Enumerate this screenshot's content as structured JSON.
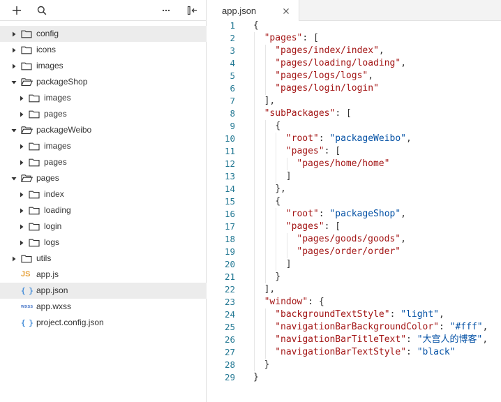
{
  "toolbar": {
    "icons": [
      "add-icon",
      "search-icon",
      "more-icon",
      "collapse-panel-icon"
    ]
  },
  "tree": [
    {
      "label": "config",
      "type": "folder",
      "expanded": false,
      "depth": 0,
      "selected": true
    },
    {
      "label": "icons",
      "type": "folder",
      "expanded": false,
      "depth": 0
    },
    {
      "label": "images",
      "type": "folder",
      "expanded": false,
      "depth": 0
    },
    {
      "label": "packageShop",
      "type": "folder",
      "expanded": true,
      "depth": 0
    },
    {
      "label": "images",
      "type": "folder",
      "expanded": false,
      "depth": 1
    },
    {
      "label": "pages",
      "type": "folder",
      "expanded": false,
      "depth": 1
    },
    {
      "label": "packageWeibo",
      "type": "folder",
      "expanded": true,
      "depth": 0
    },
    {
      "label": "images",
      "type": "folder",
      "expanded": false,
      "depth": 1
    },
    {
      "label": "pages",
      "type": "folder",
      "expanded": false,
      "depth": 1
    },
    {
      "label": "pages",
      "type": "folder",
      "expanded": true,
      "depth": 0
    },
    {
      "label": "index",
      "type": "folder",
      "expanded": false,
      "depth": 1
    },
    {
      "label": "loading",
      "type": "folder",
      "expanded": false,
      "depth": 1
    },
    {
      "label": "login",
      "type": "folder",
      "expanded": false,
      "depth": 1
    },
    {
      "label": "logs",
      "type": "folder",
      "expanded": false,
      "depth": 1
    },
    {
      "label": "utils",
      "type": "folder",
      "expanded": false,
      "depth": 0
    },
    {
      "label": "app.js",
      "type": "file",
      "badge": "JS",
      "badgeClass": "badge-js",
      "depth": 0
    },
    {
      "label": "app.json",
      "type": "file",
      "badge": "{ }",
      "badgeClass": "badge-json",
      "depth": 0,
      "selected": true
    },
    {
      "label": "app.wxss",
      "type": "file",
      "badge": "wxss",
      "badgeClass": "badge-wxss",
      "depth": 0
    },
    {
      "label": "project.config.json",
      "type": "file",
      "badge": "{ }",
      "badgeClass": "badge-json",
      "depth": 0
    }
  ],
  "editor": {
    "tab_title": "app.json",
    "lines": [
      {
        "n": "1",
        "indent": 0,
        "tokens": [
          [
            "p",
            "{"
          ]
        ]
      },
      {
        "n": "2",
        "indent": 1,
        "tokens": [
          [
            "k",
            "\"pages\""
          ],
          [
            "p",
            ": ["
          ]
        ]
      },
      {
        "n": "3",
        "indent": 2,
        "tokens": [
          [
            "k",
            "\"pages/index/index\""
          ],
          [
            "p",
            ","
          ]
        ]
      },
      {
        "n": "4",
        "indent": 2,
        "tokens": [
          [
            "k",
            "\"pages/loading/loading\""
          ],
          [
            "p",
            ","
          ]
        ]
      },
      {
        "n": "5",
        "indent": 2,
        "tokens": [
          [
            "k",
            "\"pages/logs/logs\""
          ],
          [
            "p",
            ","
          ]
        ]
      },
      {
        "n": "6",
        "indent": 2,
        "tokens": [
          [
            "k",
            "\"pages/login/login\""
          ]
        ]
      },
      {
        "n": "7",
        "indent": 1,
        "tokens": [
          [
            "p",
            "],"
          ]
        ]
      },
      {
        "n": "8",
        "indent": 1,
        "tokens": [
          [
            "k",
            "\"subPackages\""
          ],
          [
            "p",
            ": ["
          ]
        ]
      },
      {
        "n": "9",
        "indent": 2,
        "tokens": [
          [
            "p",
            "{"
          ]
        ]
      },
      {
        "n": "10",
        "indent": 3,
        "tokens": [
          [
            "k",
            "\"root\""
          ],
          [
            "p",
            ": "
          ],
          [
            "s",
            "\"packageWeibo\""
          ],
          [
            "p",
            ","
          ]
        ]
      },
      {
        "n": "11",
        "indent": 3,
        "tokens": [
          [
            "k",
            "\"pages\""
          ],
          [
            "p",
            ": ["
          ]
        ]
      },
      {
        "n": "12",
        "indent": 4,
        "tokens": [
          [
            "k",
            "\"pages/home/home\""
          ]
        ]
      },
      {
        "n": "13",
        "indent": 3,
        "tokens": [
          [
            "p",
            "]"
          ]
        ]
      },
      {
        "n": "14",
        "indent": 2,
        "tokens": [
          [
            "p",
            "},"
          ]
        ]
      },
      {
        "n": "15",
        "indent": 2,
        "tokens": [
          [
            "p",
            "{"
          ]
        ]
      },
      {
        "n": "16",
        "indent": 3,
        "tokens": [
          [
            "k",
            "\"root\""
          ],
          [
            "p",
            ": "
          ],
          [
            "s",
            "\"packageShop\""
          ],
          [
            "p",
            ","
          ]
        ]
      },
      {
        "n": "17",
        "indent": 3,
        "tokens": [
          [
            "k",
            "\"pages\""
          ],
          [
            "p",
            ": ["
          ]
        ]
      },
      {
        "n": "18",
        "indent": 4,
        "tokens": [
          [
            "k",
            "\"pages/goods/goods\""
          ],
          [
            "p",
            ","
          ]
        ]
      },
      {
        "n": "19",
        "indent": 4,
        "tokens": [
          [
            "k",
            "\"pages/order/order\""
          ]
        ]
      },
      {
        "n": "20",
        "indent": 3,
        "tokens": [
          [
            "p",
            "]"
          ]
        ]
      },
      {
        "n": "21",
        "indent": 2,
        "tokens": [
          [
            "p",
            "}"
          ]
        ]
      },
      {
        "n": "22",
        "indent": 1,
        "tokens": [
          [
            "p",
            "],"
          ]
        ]
      },
      {
        "n": "23",
        "indent": 1,
        "tokens": [
          [
            "k",
            "\"window\""
          ],
          [
            "p",
            ": {"
          ]
        ]
      },
      {
        "n": "24",
        "indent": 2,
        "tokens": [
          [
            "k",
            "\"backgroundTextStyle\""
          ],
          [
            "p",
            ": "
          ],
          [
            "s",
            "\"light\""
          ],
          [
            "p",
            ","
          ]
        ]
      },
      {
        "n": "25",
        "indent": 2,
        "tokens": [
          [
            "k",
            "\"navigationBarBackgroundColor\""
          ],
          [
            "p",
            ": "
          ],
          [
            "s",
            "\"#fff\""
          ],
          [
            "p",
            ","
          ]
        ]
      },
      {
        "n": "26",
        "indent": 2,
        "tokens": [
          [
            "k",
            "\"navigationBarTitleText\""
          ],
          [
            "p",
            ": "
          ],
          [
            "s",
            "\"大宫人的博客\""
          ],
          [
            "p",
            ","
          ]
        ]
      },
      {
        "n": "27",
        "indent": 2,
        "tokens": [
          [
            "k",
            "\"navigationBarTextStyle\""
          ],
          [
            "p",
            ": "
          ],
          [
            "s",
            "\"black\""
          ]
        ]
      },
      {
        "n": "28",
        "indent": 1,
        "tokens": [
          [
            "p",
            "}"
          ]
        ]
      },
      {
        "n": "29",
        "indent": 0,
        "tokens": [
          [
            "p",
            "}"
          ]
        ]
      }
    ]
  },
  "colors": {
    "key": "#a31515",
    "string": "#0451a5",
    "line_number": "#237893",
    "selected_row": "#ececec",
    "js_badge": "#e6a23c",
    "json_badge": "#4a90d9"
  }
}
